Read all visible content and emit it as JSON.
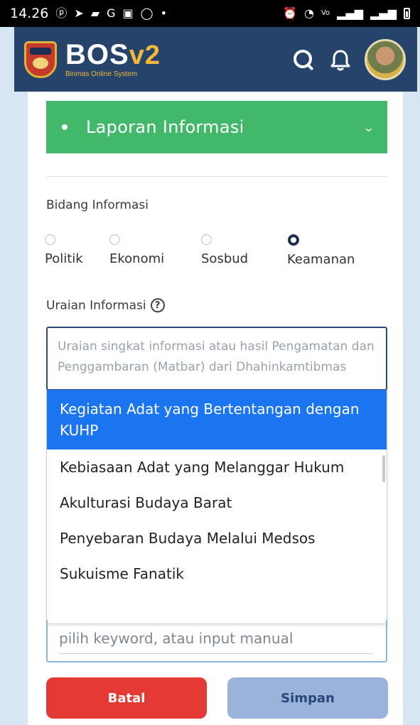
{
  "status_bar": {
    "time": "14.26",
    "left_icons": [
      "notification-icon",
      "send-icon",
      "chat-icon",
      "google-icon",
      "photo-icon",
      "circle-icon",
      "dot-icon"
    ],
    "right_icons": [
      "alarm-icon",
      "wifi-icon",
      "volte-icon",
      "signal-icon",
      "signal-icon",
      "battery-icon"
    ]
  },
  "app": {
    "brand_main": "BOS",
    "brand_version": "v2",
    "brand_tagline": "Binmas Online System",
    "accent": "#f3b83a",
    "header_bg": "#25436b"
  },
  "section": {
    "title": "Laporan Informasi",
    "color": "#41b86a"
  },
  "bidang": {
    "label": "Bidang Informasi",
    "options": [
      "Politik",
      "Ekonomi",
      "Sosbud",
      "Keamanan"
    ],
    "selected": "Keamanan"
  },
  "uraian": {
    "label": "Uraian Informasi",
    "placeholder": "Uraian singkat informasi atau hasil Pengamatan dan Penggambaran (Matbar) dari Dhahinkamtibmas"
  },
  "dropdown": {
    "options": [
      "Kegiatan Adat yang Bertentangan dengan KUHP",
      "Kebiasaan Adat yang Melanggar Hukum",
      "Akulturasi Budaya Barat",
      "Penyebaran Budaya Melalui Medsos",
      "Sukuisme Fanatik"
    ],
    "selected_index": 0,
    "highlight": "#1b74f0"
  },
  "keyword": {
    "placeholder": "pilih keyword, atau input manual"
  },
  "buttons": {
    "cancel": "Batal",
    "save": "Simpan"
  }
}
